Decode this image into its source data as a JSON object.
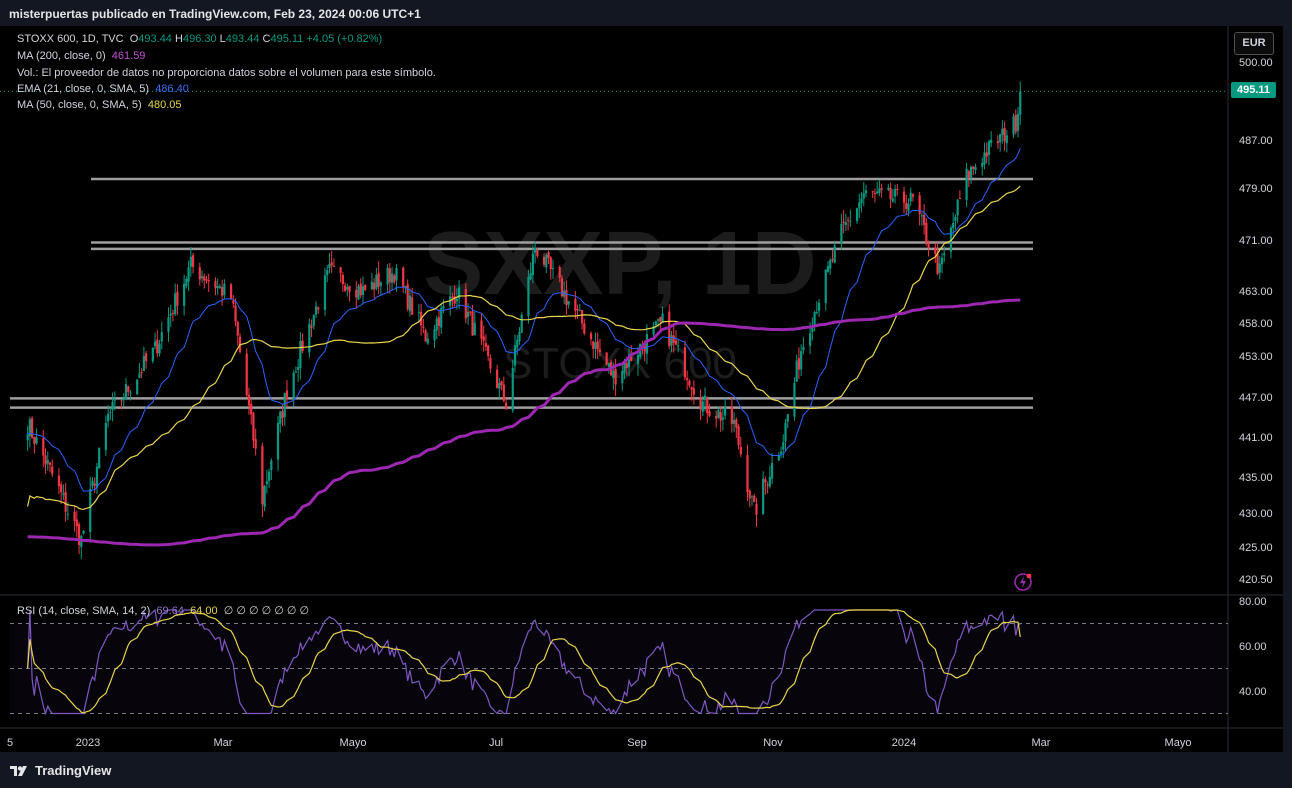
{
  "header": "misterpuertas publicado en TradingView.com, Feb 23, 2024 00:06 UTC+1",
  "legend": {
    "symbol_line": {
      "name": "STOXX 600, 1D, TVC",
      "o_label": "O",
      "o": "493.44",
      "h_label": "H",
      "h": "496.30",
      "l_label": "L",
      "l": "493.44",
      "c_label": "C",
      "c": "495.11",
      "chg": "+4.05 (+0.82%)"
    },
    "ma200": {
      "label": "MA (200, close, 0)",
      "value": "461.59"
    },
    "vol": "Vol.: El proveedor de datos no proporciona datos sobre el volumen para este símbolo.",
    "ema21": {
      "label": "EMA (21, close, 0, SMA, 5)",
      "value": "486.40"
    },
    "ma50": {
      "label": "MA (50, close, 0, SMA, 5)",
      "value": "480.05"
    }
  },
  "currency": "EUR",
  "current_price": "495.11",
  "watermark": {
    "symbol": "SXXP, 1D",
    "name": "STOXX 600"
  },
  "rsi_legend": {
    "label": "RSI (14, close, SMA, 14, 2)",
    "value": "69.64",
    "sma": "64.00",
    "extra": "∅ ∅ ∅ ∅ ∅ ∅ ∅"
  },
  "footer": {
    "brand": "TradingView"
  },
  "colors": {
    "up": "#089981",
    "down": "#f23645",
    "ma200": "#9c27b0",
    "ema21": "#2962ff",
    "ma50": "#e8d44d",
    "rsi": "#7e57c2",
    "rsi_sma": "#e8d44d",
    "hline": "#9e9e9e"
  },
  "chart_data": [
    {
      "type": "candlestick",
      "title": "STOXX 600, 1D, TVC",
      "x_labels": [
        "5",
        "2023",
        "Mar",
        "Mayo",
        "Jul",
        "Sep",
        "Nov",
        "2024",
        "Mar",
        "Mayo"
      ],
      "y_ticks": [
        "500.00",
        "487.00",
        "479.00",
        "471.00",
        "463.00",
        "458.00",
        "453.00",
        "447.00",
        "441.00",
        "435.00",
        "430.00",
        "425.00",
        "420.50"
      ],
      "ylim": [
        419,
        504
      ],
      "grid": false,
      "horizontal_levels": [
        480.5,
        470.6,
        469.6,
        446.8,
        445.4
      ],
      "ohlc_anchor_closes": [
        [
          "2022-12-05",
          443.0
        ],
        [
          "2022-12-15",
          436.0
        ],
        [
          "2022-12-29",
          426.0
        ],
        [
          "2023-01-10",
          444.0
        ],
        [
          "2023-01-31",
          454.0
        ],
        [
          "2023-02-16",
          467.0
        ],
        [
          "2023-03-06",
          462.0
        ],
        [
          "2023-03-15",
          443.0
        ],
        [
          "2023-03-20",
          432.0
        ],
        [
          "2023-03-31",
          448.0
        ],
        [
          "2023-04-19",
          466.0
        ],
        [
          "2023-05-04",
          463.0
        ],
        [
          "2023-05-18",
          466.0
        ],
        [
          "2023-06-01",
          456.0
        ],
        [
          "2023-06-15",
          463.0
        ],
        [
          "2023-07-07",
          446.0
        ],
        [
          "2023-07-20",
          470.0
        ],
        [
          "2023-08-10",
          458.0
        ],
        [
          "2023-08-24",
          450.0
        ],
        [
          "2023-09-15",
          458.0
        ],
        [
          "2023-10-03",
          446.0
        ],
        [
          "2023-10-17",
          443.0
        ],
        [
          "2023-10-26",
          430.0
        ],
        [
          "2023-11-08",
          441.0
        ],
        [
          "2023-11-16",
          454.0
        ],
        [
          "2023-12-04",
          472.0
        ],
        [
          "2023-12-14",
          478.0
        ],
        [
          "2024-01-05",
          477.0
        ],
        [
          "2024-01-17",
          466.0
        ],
        [
          "2024-01-29",
          481.0
        ],
        [
          "2024-02-09",
          486.0
        ],
        [
          "2024-02-15",
          488.0
        ],
        [
          "2024-02-20",
          490.0
        ],
        [
          "2024-02-22",
          495.11
        ]
      ],
      "series": [
        {
          "name": "MA (200, close, 0)",
          "last": 461.59
        },
        {
          "name": "EMA (21, close, 0, SMA, 5)",
          "last": 486.4
        },
        {
          "name": "MA (50, close, 0, SMA, 5)",
          "last": 480.05
        }
      ]
    },
    {
      "type": "line",
      "title": "RSI (14, close, SMA, 14, 2)",
      "y_ticks": [
        "80.00",
        "60.00",
        "40.00"
      ],
      "ylim": [
        28,
        84
      ],
      "levels": [
        70,
        50,
        30
      ],
      "series": [
        {
          "name": "RSI",
          "last": 69.64
        },
        {
          "name": "RSI SMA",
          "last": 64.0
        }
      ]
    }
  ]
}
